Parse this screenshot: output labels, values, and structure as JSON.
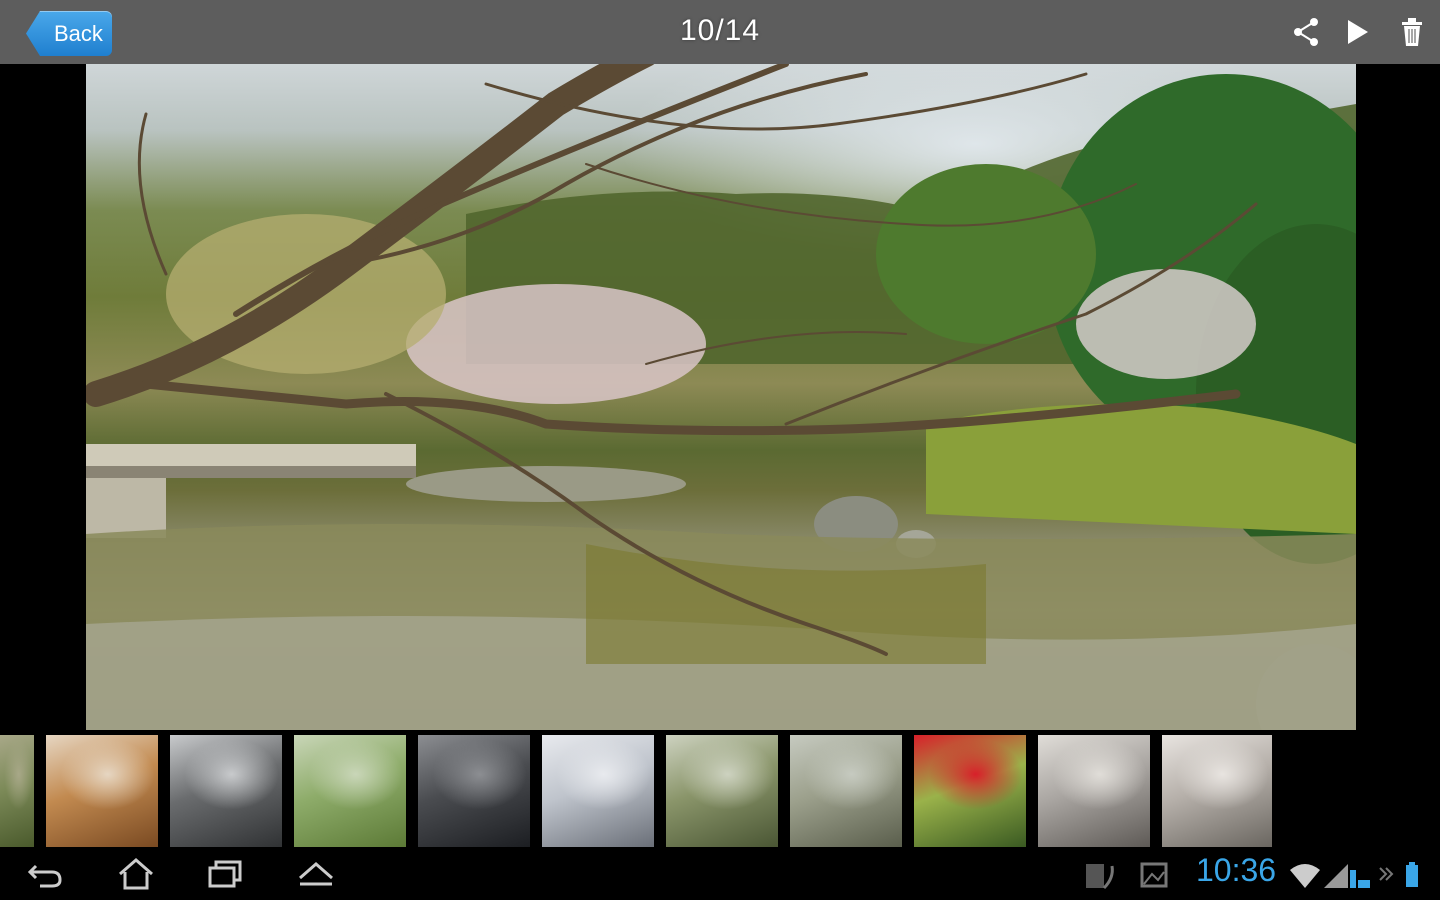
{
  "topbar": {
    "back_label": "Back",
    "counter": "10/14"
  },
  "photo": {
    "description_icon": "photo-viewer-image"
  },
  "thumbnails": [
    {
      "name": "thumb-1",
      "colors": [
        "#4a5a2c",
        "#7c8a58",
        "#a8a888"
      ]
    },
    {
      "name": "thumb-2",
      "colors": [
        "#7a4a22",
        "#c28a50",
        "#e6d6c2"
      ]
    },
    {
      "name": "thumb-3",
      "colors": [
        "#303234",
        "#6a6c6e",
        "#c8cacc"
      ]
    },
    {
      "name": "thumb-4",
      "colors": [
        "#5c7a36",
        "#8eac6a",
        "#c9d6b8"
      ]
    },
    {
      "name": "thumb-5",
      "colors": [
        "#1c1e22",
        "#4a4c50",
        "#8c8e92"
      ]
    },
    {
      "name": "thumb-6",
      "colors": [
        "#6a6f78",
        "#bfc4cc",
        "#e8eaee"
      ]
    },
    {
      "name": "thumb-7",
      "colors": [
        "#4a5634",
        "#8a956a",
        "#cdd2c0"
      ]
    },
    {
      "name": "thumb-8",
      "colors": [
        "#5a5e4c",
        "#9ca08c",
        "#c6cac0"
      ]
    },
    {
      "name": "thumb-9",
      "colors": [
        "#3a5a22",
        "#9ab24a",
        "#d8202a"
      ]
    },
    {
      "name": "thumb-10",
      "colors": [
        "#5e5a56",
        "#aaa6a2",
        "#e0ddd8"
      ]
    },
    {
      "name": "thumb-11",
      "colors": [
        "#6a6660",
        "#b6b0aa",
        "#e8e4e0"
      ]
    }
  ],
  "status": {
    "time": "10:36"
  },
  "colors": {
    "accent": "#3aa6e8",
    "back_button": "#1f7fcf"
  }
}
